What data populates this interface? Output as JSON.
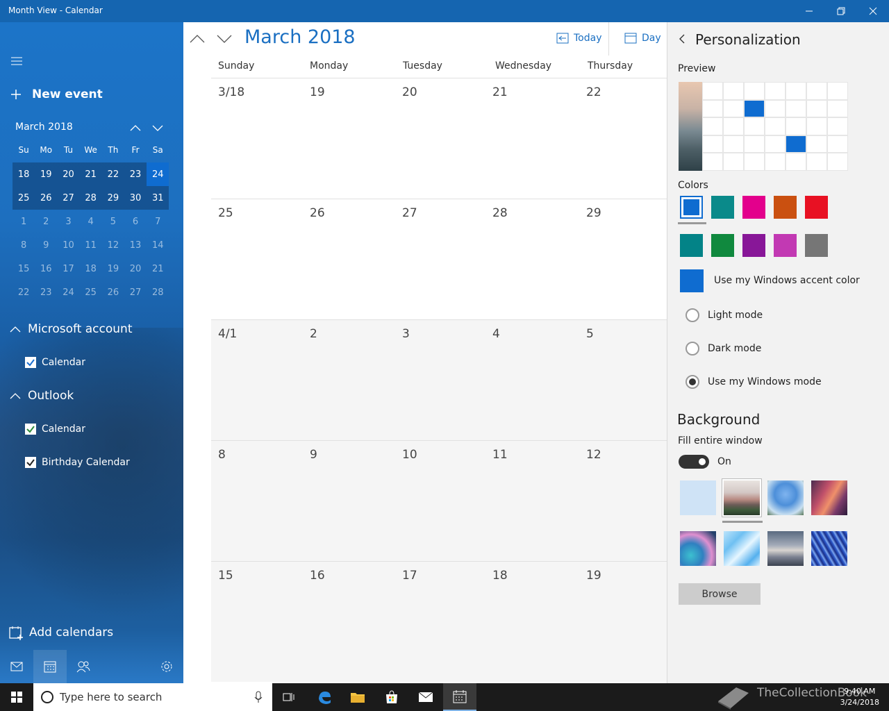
{
  "window": {
    "title": "Month View - Calendar"
  },
  "sidebar": {
    "new_event": "New event",
    "mini_calendar": {
      "title": "March 2018",
      "weekdays": [
        "Su",
        "Mo",
        "Tu",
        "We",
        "Th",
        "Fr",
        "Sa"
      ],
      "weeks": [
        [
          "18",
          "19",
          "20",
          "21",
          "22",
          "23",
          "24"
        ],
        [
          "25",
          "26",
          "27",
          "28",
          "29",
          "30",
          "31"
        ],
        [
          "1",
          "2",
          "3",
          "4",
          "5",
          "6",
          "7"
        ],
        [
          "8",
          "9",
          "10",
          "11",
          "12",
          "13",
          "14"
        ],
        [
          "15",
          "16",
          "17",
          "18",
          "19",
          "20",
          "21"
        ],
        [
          "22",
          "23",
          "24",
          "25",
          "26",
          "27",
          "28"
        ]
      ],
      "selected_day": "24"
    },
    "groups": [
      {
        "name": "Microsoft account",
        "calendars": [
          {
            "label": "Calendar",
            "color": "#1a6fd1"
          }
        ]
      },
      {
        "name": "Outlook",
        "calendars": [
          {
            "label": "Calendar",
            "color": "#2e8b3a"
          },
          {
            "label": "Birthday Calendar",
            "color": "#222222"
          }
        ]
      }
    ],
    "add_calendars": "Add calendars"
  },
  "main": {
    "month_title": "March 2018",
    "today_label": "Today",
    "view_label": "Day",
    "weekdays": [
      "Sunday",
      "Monday",
      "Tuesday",
      "Wednesday",
      "Thursday"
    ],
    "weeks": [
      [
        "3/18",
        "19",
        "20",
        "21",
        "22"
      ],
      [
        "25",
        "26",
        "27",
        "28",
        "29"
      ],
      [
        "4/1",
        "2",
        "3",
        "4",
        "5"
      ],
      [
        "8",
        "9",
        "10",
        "11",
        "12"
      ],
      [
        "15",
        "16",
        "17",
        "18",
        "19"
      ]
    ]
  },
  "panel": {
    "title": "Personalization",
    "preview_label": "Preview",
    "colors_label": "Colors",
    "colors": [
      "#0f6cd0",
      "#0a8a8a",
      "#e3008c",
      "#ca5010",
      "#e81123",
      "#038387",
      "#10893e",
      "#881798",
      "#c239b3",
      "#767676"
    ],
    "selected_color_index": 0,
    "accent_color": "#0f6cd0",
    "accent_label": "Use my Windows accent color",
    "modes": [
      "Light mode",
      "Dark mode",
      "Use my Windows mode"
    ],
    "selected_mode_index": 2,
    "background_heading": "Background",
    "fill_label": "Fill entire window",
    "toggle_state": "On",
    "browse_label": "Browse"
  },
  "taskbar": {
    "search_placeholder": "Type here to search",
    "time": "9:40 AM",
    "date": "3/24/2018",
    "watermark": "TheCollectionBook"
  }
}
